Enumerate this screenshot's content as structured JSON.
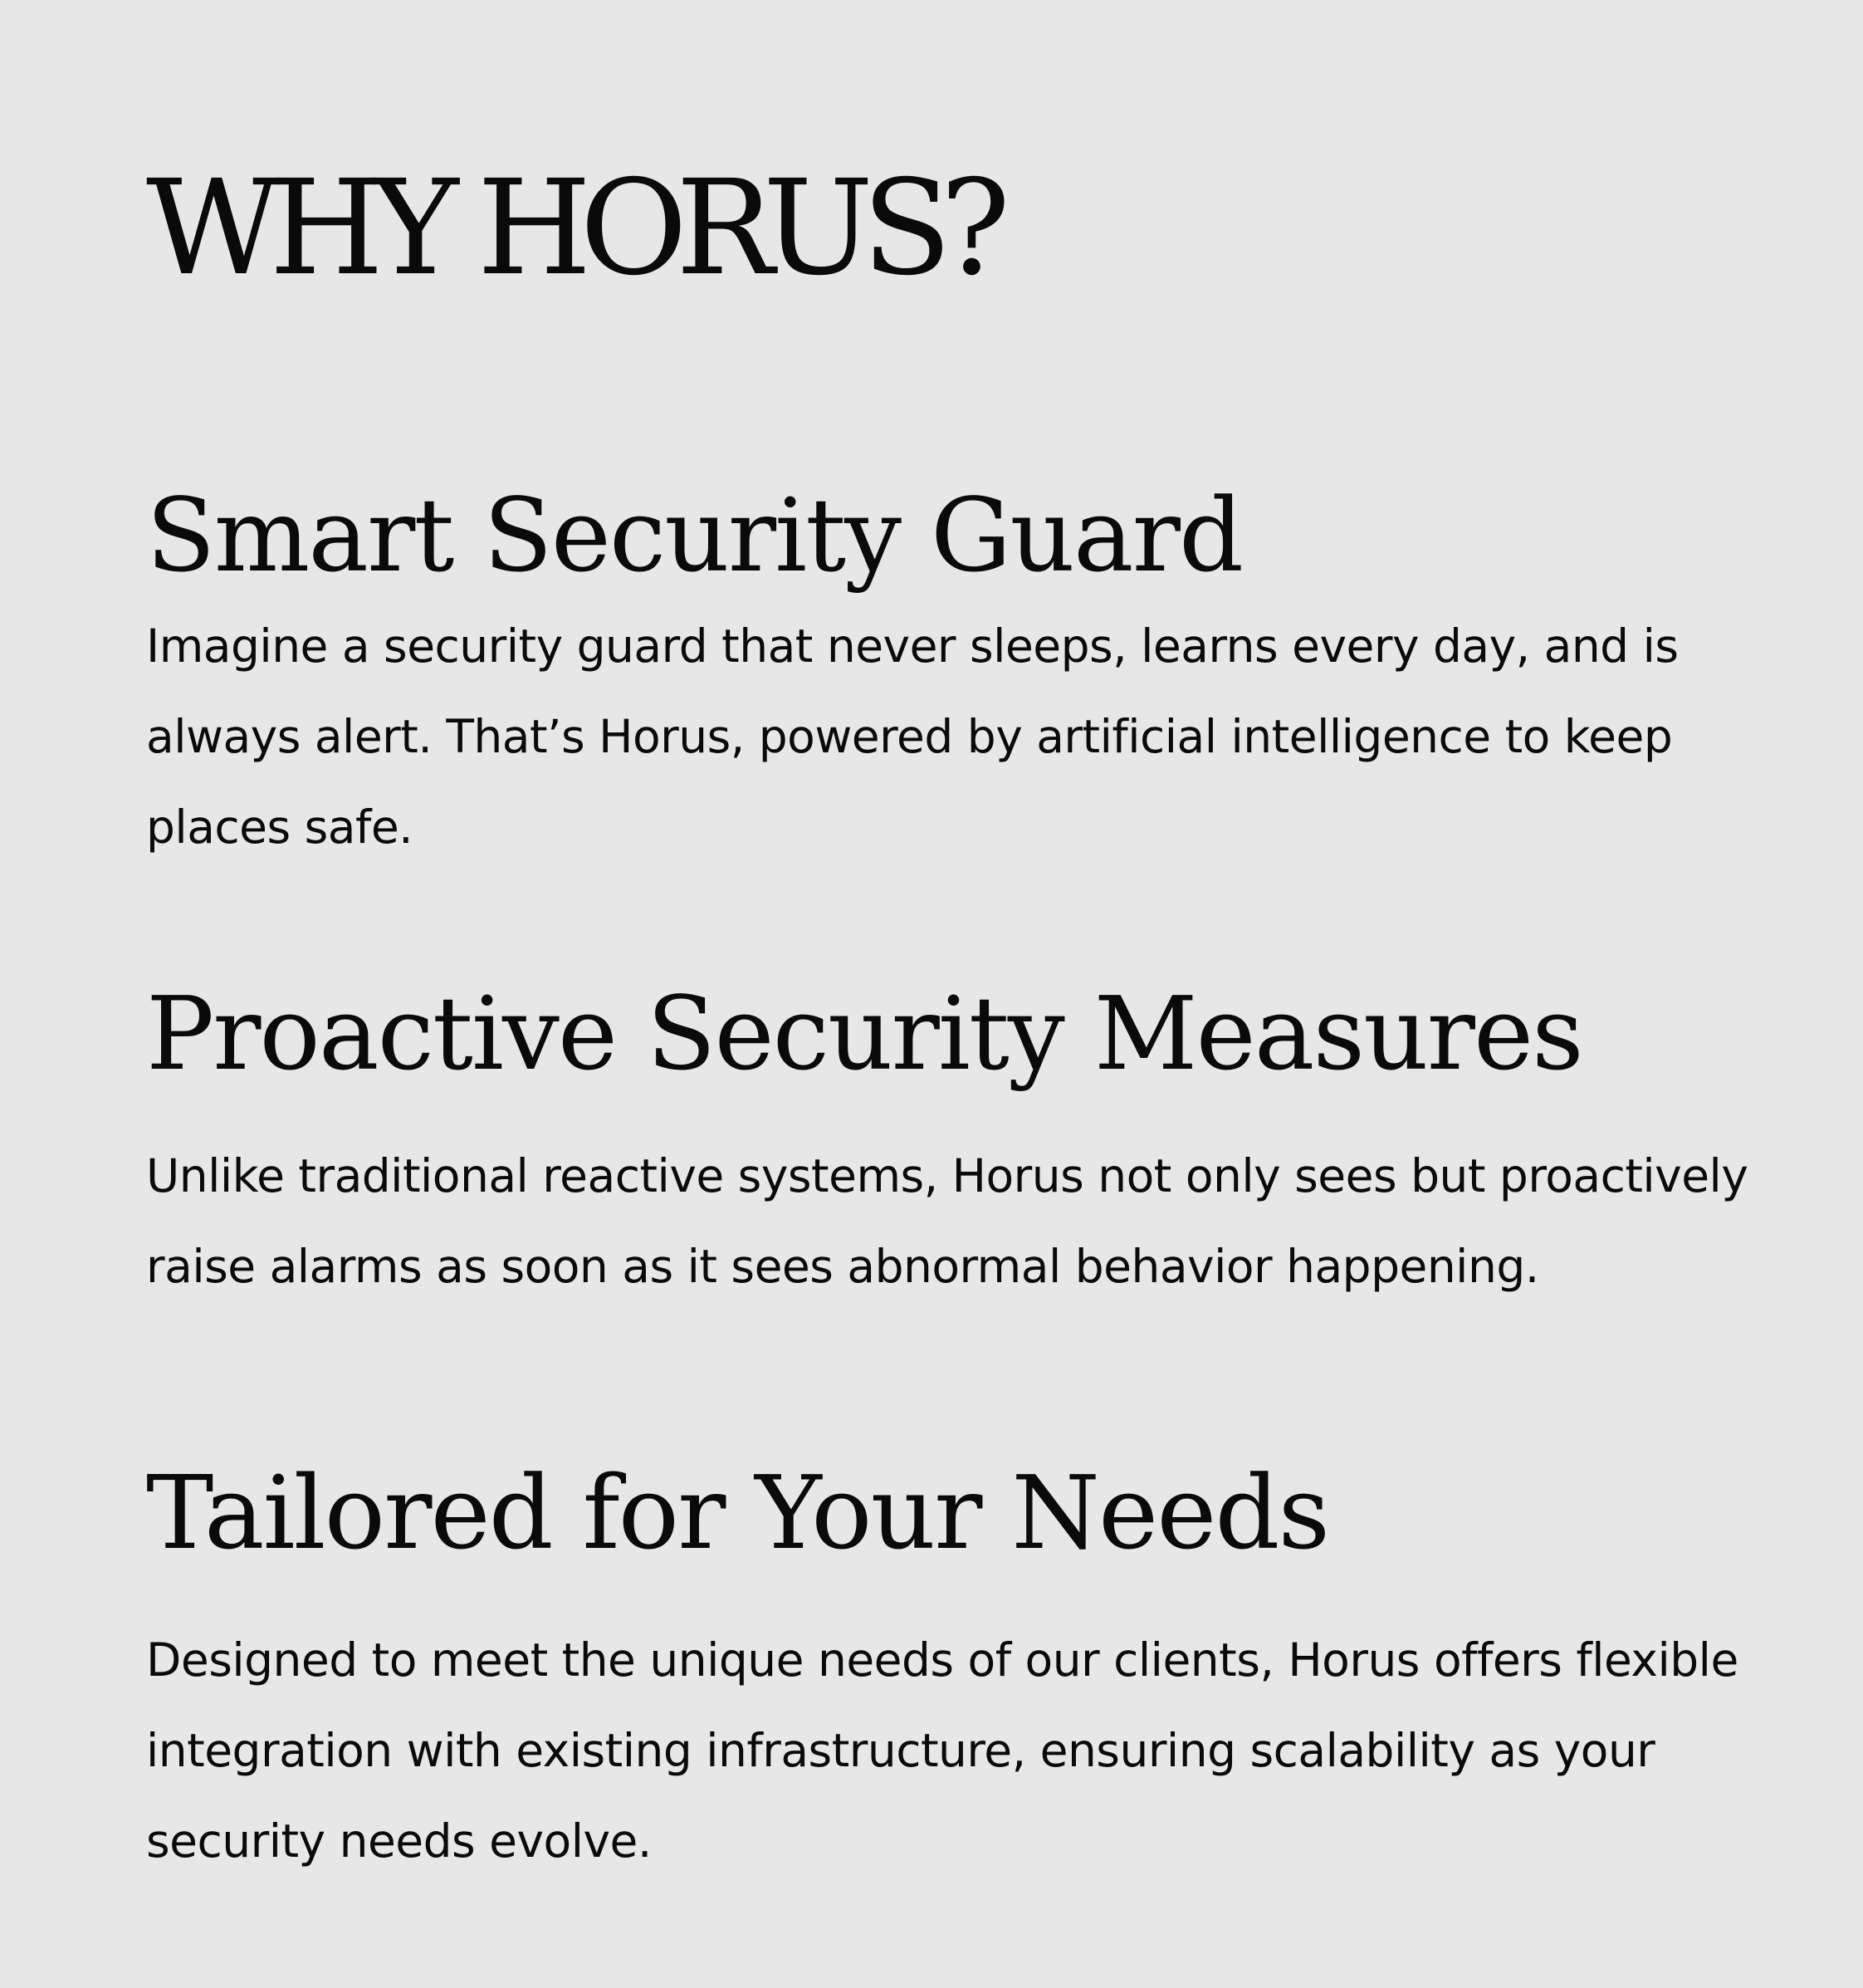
{
  "page": {
    "title": "WHY HORUS?",
    "background_color": "#e7e7e7",
    "text_color": "#0a0a0a"
  },
  "sections": [
    {
      "heading": "Smart Security Guard",
      "body": "Imagine a security guard that never sleeps, learns every day, and is always alert. That’s Horus, powered by artificial intelligence to keep places safe."
    },
    {
      "heading": "Proactive Security Measures",
      "body": "Unlike traditional reactive systems, Horus not only sees but proactively raise alarms as soon as it sees abnormal behavior happening."
    },
    {
      "heading": "Tailored for Your Needs",
      "body": "Designed to meet the unique needs of our clients, Horus offers flexible integration with existing infrastructure, ensuring scalability as your security needs evolve."
    }
  ]
}
